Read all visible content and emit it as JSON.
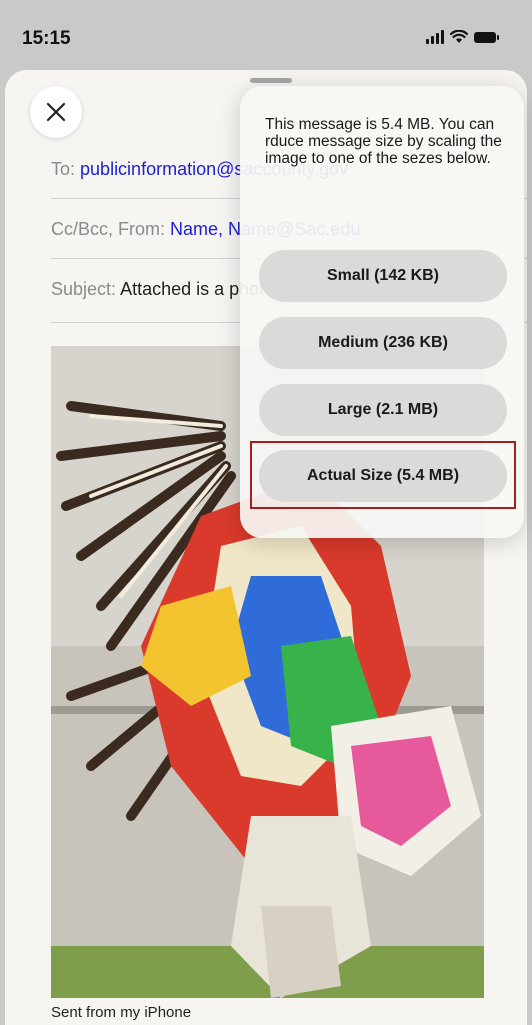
{
  "status_bar": {
    "time": "15:15"
  },
  "compose": {
    "to_label": "To:",
    "to_value": "publicinformation@saccounty.gov",
    "ccbcc_label": "Cc/Bcc, From:",
    "from_value": "Name, Name@Sac.edu",
    "subject_label": "Subject:",
    "subject_value": "Attached is a photo of...",
    "signature": "Sent from my iPhone"
  },
  "size_popover": {
    "message": "This message is 5.4 MB. You can rduce message size by scaling the image to one of the sezes below.",
    "options": [
      {
        "label": "Small (142 KB)"
      },
      {
        "label": "Medium (236 KB)"
      },
      {
        "label": "Large (2.1 MB)"
      },
      {
        "label": "Actual Size (5.4 MB)"
      }
    ]
  },
  "colors": {
    "link": "#1d1dd6",
    "highlight": "#a51d1d"
  }
}
